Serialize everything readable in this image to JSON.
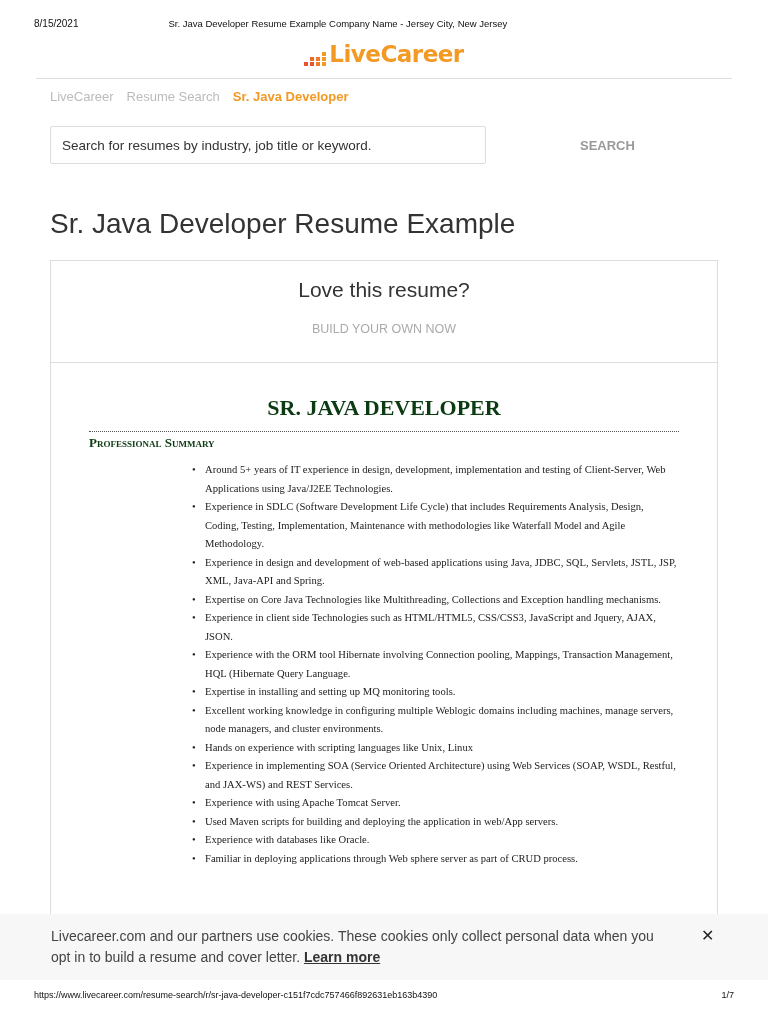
{
  "print_header": {
    "date": "8/15/2021",
    "title": "Sr. Java Developer Resume Example Company Name - Jersey City, New Jersey"
  },
  "logo": {
    "text": "LiveCareer"
  },
  "breadcrumbs": [
    {
      "label": "LiveCareer",
      "selected": false
    },
    {
      "label": "Resume Search",
      "selected": false
    },
    {
      "label": "Sr. Java Developer",
      "selected": true
    }
  ],
  "search": {
    "placeholder": "Search for resumes by industry, job title or keyword.",
    "button": "SEARCH"
  },
  "heading": "Sr. Java Developer Resume Example",
  "promo": {
    "title": "Love this resume?",
    "link": "BUILD YOUR OWN NOW"
  },
  "resume": {
    "name": "SR. JAVA DEVELOPER",
    "section_title": "Professional Summary",
    "bullets": [
      {
        "marker": "•",
        "text": "Around 5+ years of IT experience in design, development, implementation and testing of Client-Server, Web Applications using Java/J2EE Technologies."
      },
      {
        "marker": "•",
        "text": "Experience in SDLC (Software Development Life Cycle) that includes Requirements Analysis, Design, Coding, Testing, Implementation, Maintenance with methodologies like Waterfall Model and Agile Methodology."
      },
      {
        "marker": "•",
        "text": "Experience in design and development of web-based applications using Java, JDBC, SQL, Servlets, JSTL, JSP, XML, Java-API and Spring."
      },
      {
        "marker": "•",
        "text": "Expertise on Core Java Technologies like Multithreading, Collections and Exception handling mechanisms."
      },
      {
        "marker": "•",
        "text": "Experience in client side Technologies such as HTML/HTML5, CSS/CSS3, JavaScript and Jquery, AJAX, JSON."
      },
      {
        "marker": "•",
        "text": "Experience with the ORM tool Hibernate involving Connection pooling, Mappings, Transaction Management, HQL (Hibernate Query Language."
      },
      {
        "marker": "•",
        "text": "Expertise in installing and setting up MQ monitoring tools."
      },
      {
        "marker": "•",
        "text": "Excellent working knowledge in configuring multiple Weblogic domains including machines, manage servers, node managers, and cluster environments."
      },
      {
        "marker": "•",
        "text": "Hands on experience with scripting languages like Unix, Linux"
      },
      {
        "marker": "•",
        "text": "Experience in implementing SOA (Service Oriented Architecture) using Web Services (SOAP, WSDL, Restful, and JAX-WS) and REST Services."
      },
      {
        "marker": "•",
        "text": "Experience with using Apache Tomcat Server."
      },
      {
        "marker": "•",
        "text": "Used Maven scripts for building and deploying the application in web/App servers."
      },
      {
        "marker": "•",
        "text": "Experience with databases like Oracle."
      },
      {
        "marker": "•",
        "text": "Familiar in deploying applications through Web sphere server as part of CRUD process."
      }
    ]
  },
  "cookie_banner": {
    "text": "Livecareer.com and our partners use cookies. These cookies only collect personal data when you opt in to build a resume and cover letter.",
    "link": "Learn more",
    "close": "✕"
  },
  "print_footer": {
    "url": "https://www.livecareer.com/resume-search/r/sr-java-developer-c151f7cdc757466f892631eb163b4390",
    "page": "1/7"
  }
}
